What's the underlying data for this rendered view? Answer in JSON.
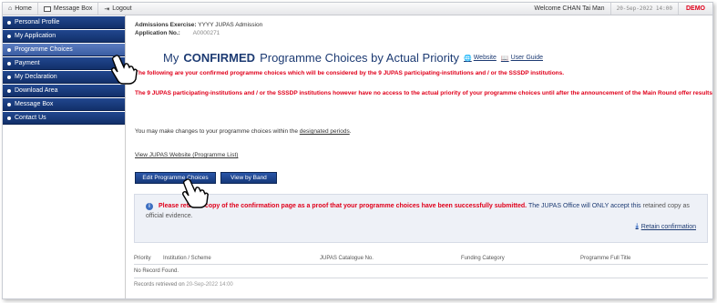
{
  "topbar": {
    "home": "Home",
    "message_box": "Message Box",
    "logout": "Logout",
    "welcome": "Welcome CHAN Tai Man",
    "datetime": "20-Sep-2022 14:00",
    "demo": "DEMO"
  },
  "sidebar": {
    "items": [
      {
        "label": "Personal Profile"
      },
      {
        "label": "My Application"
      },
      {
        "label": "Programme Choices"
      },
      {
        "label": "Payment"
      },
      {
        "label": "My Declaration"
      },
      {
        "label": "Download Area"
      },
      {
        "label": "Message Box"
      },
      {
        "label": "Contact Us"
      }
    ]
  },
  "main": {
    "admissions_exercise_label": "Admissions Exercise:",
    "admissions_exercise_value": "YYYY JUPAS Admission",
    "application_no_label": "Application No.:",
    "application_no_value": "A0000271",
    "heading_prefix": "My",
    "heading_bold": "CONFIRMED",
    "heading_suffix": "Programme Choices by Actual Priority",
    "website_link": "Website",
    "user_guide_link": "User Guide",
    "red_note_1": "The following are your confirmed programme choices which will be considered by the 9 JUPAS participating-institutions and / or the SSSDP institutions.",
    "red_note_2": "The 9 JUPAS participating-institutions and / or the SSSDP institutions however have no access to the actual priority of your programme choices until after the announcement of the Main Round offer results.",
    "change_text_prefix": "You may make changes to your programme choices within the",
    "change_text_link": "designated periods",
    "change_text_suffix": ".",
    "programme_list_link": "View JUPAS Website (Programme List)",
    "edit_button": "Edit Programme Choices",
    "band_button": "View by Band",
    "notice_red": "Please retain a copy of the confirmation page as a proof that your programme choices have been successfully submitted.",
    "notice_blue": "The JUPAS Office will ONLY accept this",
    "notice_grey": "retained copy as official evidence.",
    "retain_link": "Retain confirmation"
  },
  "table": {
    "headers": [
      "Priority",
      "Institution / Scheme",
      "JUPAS Catalogue No.",
      "Funding Category",
      "Programme Full Title"
    ],
    "empty_text": "No Record Found.",
    "retrieved_label": "Records retrieved on",
    "retrieved_value": "20-Sep-2022 14:00"
  },
  "colors": {
    "nav_blue": "#1a3a7c",
    "alert_red": "#e0001b",
    "heading_blue": "#1d3b73"
  }
}
